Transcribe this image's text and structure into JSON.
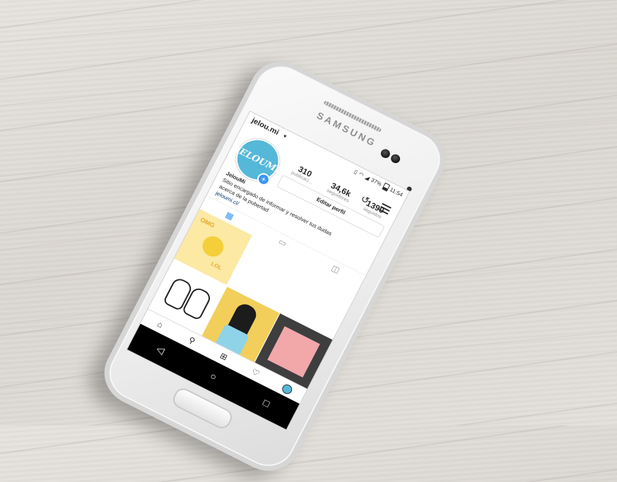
{
  "scene": {
    "device_brand": "SAMSUNG",
    "table_color": "#e4e1dc",
    "phone_color": "#f2f2f2"
  },
  "profile": {
    "username": "jelou.mi",
    "username_chevron": "chevron-down-icon",
    "avatar_text": "JELOUMI",
    "status": {
      "icons": [
        "vibrate-icon",
        "wifi-icon",
        "signal-icon"
      ],
      "battery": "37%",
      "time": "11:54"
    },
    "stats": [
      {
        "value": "310",
        "label": "publicaci..."
      },
      {
        "value": "34,6k",
        "label": "seguidores"
      },
      {
        "value": "1390",
        "label": "seguidos"
      }
    ],
    "edit_label": "Editar perfil",
    "bio": {
      "name": "JelouMi",
      "line1": "Sitio encargado de informar y resolver tus dudas",
      "line2": "acerca de la pubertad",
      "link": "jeloumi.cl/"
    }
  },
  "tabs": [
    {
      "icon": "grid-icon",
      "active": true
    },
    {
      "icon": "portrait-icon",
      "active": false
    },
    {
      "icon": "tagged-icon",
      "active": false
    }
  ],
  "grid_text": {
    "cell1_omg": "OMG",
    "cell1_lol": "LOL"
  },
  "bottom_nav": [
    "home-icon",
    "search-icon",
    "add-post-icon",
    "heart-icon",
    "profile-avatar-icon"
  ],
  "system_nav": [
    "back-icon",
    "home-circle-icon",
    "recents-icon"
  ],
  "colors": {
    "accent": "#3897f0",
    "avatar_bg": "#55b8d8",
    "link": "#003569"
  }
}
